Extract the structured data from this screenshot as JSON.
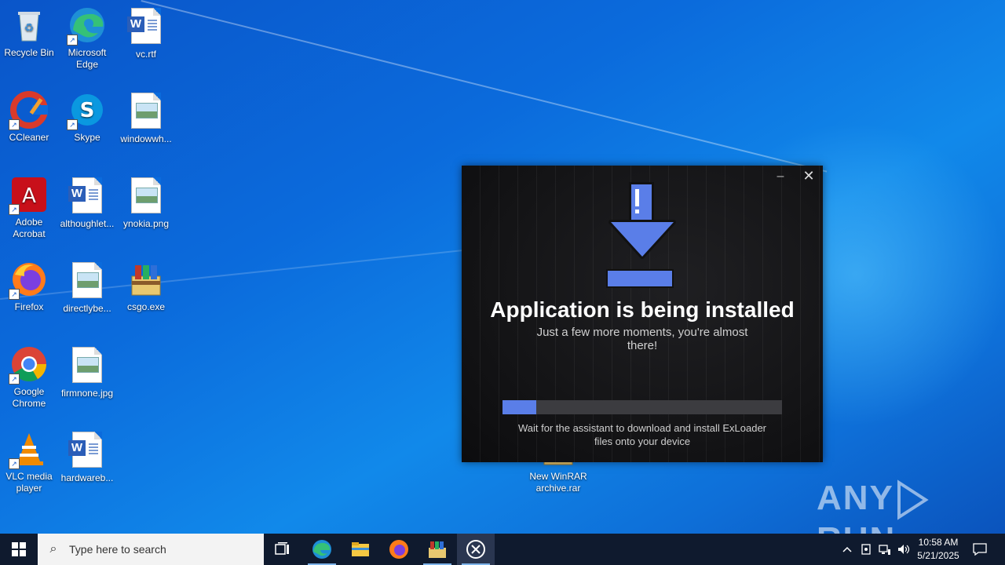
{
  "desktop": {
    "icons": [
      {
        "label": "Recycle Bin"
      },
      {
        "label": "Microsoft Edge"
      },
      {
        "label": "vc.rtf"
      },
      {
        "label": "CCleaner"
      },
      {
        "label": "Skype"
      },
      {
        "label": "windowwh..."
      },
      {
        "label": "Adobe Acrobat"
      },
      {
        "label": "althoughlet..."
      },
      {
        "label": "ynokia.png"
      },
      {
        "label": "Firefox"
      },
      {
        "label": "directlybe..."
      },
      {
        "label": "csgo.exe"
      },
      {
        "label": "Google Chrome"
      },
      {
        "label": "firmnone.jpg"
      },
      {
        "label": "VLC media player"
      },
      {
        "label": "hardwareb..."
      },
      {
        "label": "New WinRAR archive.rar"
      }
    ]
  },
  "installer": {
    "title": "Application is being installed",
    "subtitle": "Just a few more moments, you're almost there!",
    "progress": 0.12,
    "note": "Wait for the assistant to download and install ExLoader files onto your device",
    "minimize_glyph": "–",
    "close_glyph": "✕"
  },
  "watermark": {
    "text_left": "ANY",
    "text_right": "RUN"
  },
  "taskbar": {
    "search_placeholder": "Type here to search",
    "apps": [
      {
        "icon": "task-view-icon"
      },
      {
        "icon": "edge-icon"
      },
      {
        "icon": "file-explorer-icon"
      },
      {
        "icon": "firefox-icon"
      },
      {
        "icon": "winrar-icon"
      },
      {
        "icon": "exloader-icon"
      }
    ],
    "time": "10:58 AM",
    "date": "5/21/2025"
  },
  "colors": {
    "accent": "#5a7ee8",
    "taskbar": "#0f1a2e"
  }
}
